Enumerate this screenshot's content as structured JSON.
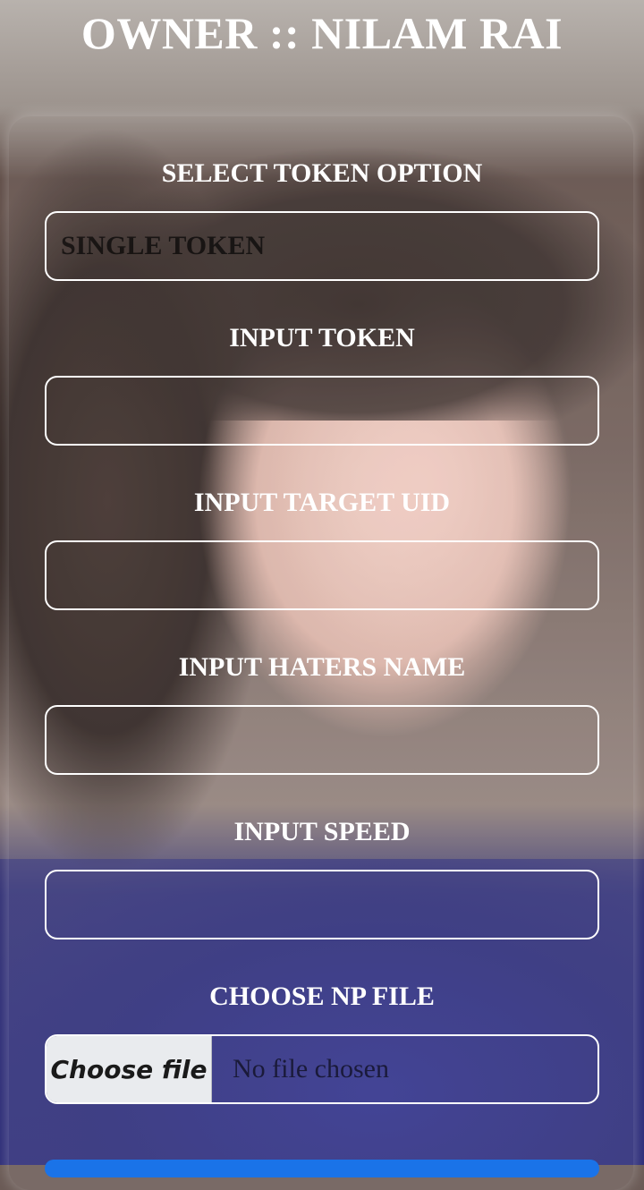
{
  "header": {
    "title": "OWNER :: NILAM RAI"
  },
  "form": {
    "token_option": {
      "label": "SELECT TOKEN OPTION",
      "selected": "SINGLE TOKEN"
    },
    "token": {
      "label": "INPUT TOKEN",
      "value": ""
    },
    "target_uid": {
      "label": "INPUT TARGET UID",
      "value": ""
    },
    "haters_name": {
      "label": "INPUT HATERS NAME",
      "value": ""
    },
    "speed": {
      "label": "INPUT SPEED",
      "value": ""
    },
    "np_file": {
      "label": "CHOOSE NP FILE",
      "button_label": "Choose file",
      "status": "No file chosen"
    }
  },
  "colors": {
    "accent": "#1a73e8",
    "text": "#ffffff",
    "field_border": "#ffffff"
  },
  "icons": {
    "background": "portrait-photo"
  }
}
